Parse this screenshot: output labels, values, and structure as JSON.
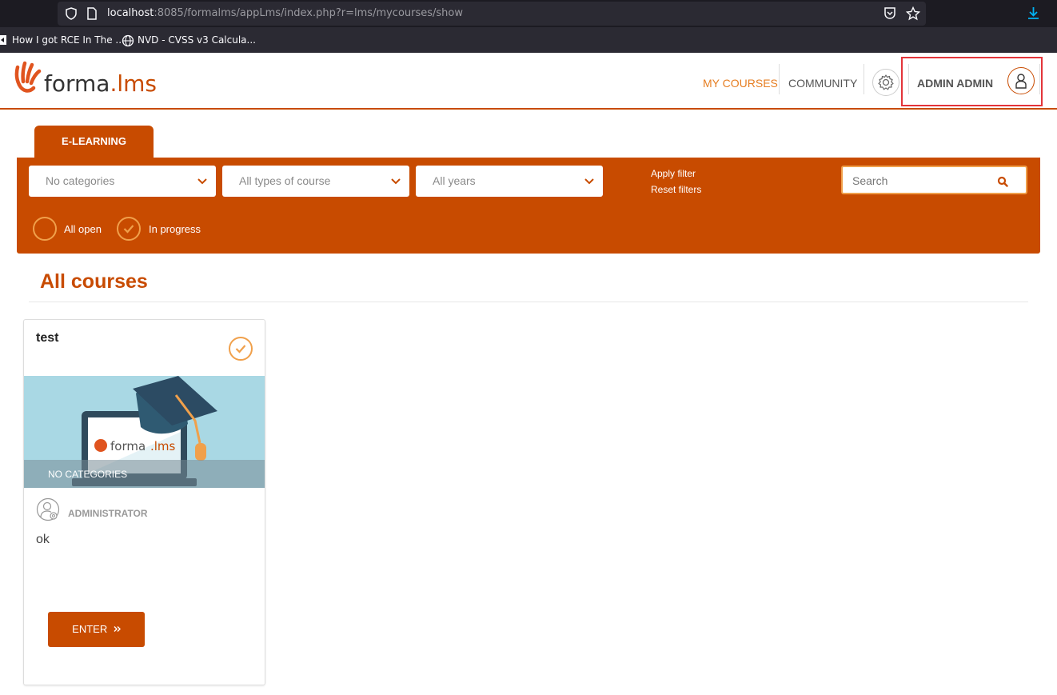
{
  "browser": {
    "url_host": "localhost",
    "url_rest": ":8085/formalms/appLms/index.php?r=lms/mycourses/show",
    "bookmarks": [
      "How I got RCE In The ...",
      "NVD - CVSS v3 Calcula..."
    ]
  },
  "header": {
    "logo_main": "forma",
    "logo_dot": ".",
    "logo_sub": "lms",
    "nav": {
      "my_courses": "MY COURSES",
      "community": "COMMUNITY"
    },
    "user_name": "ADMIN ADMIN"
  },
  "tabs": {
    "elearning": "E-LEARNING"
  },
  "filters": {
    "categories": "No categories",
    "course_types": "All types of course",
    "years": "All years",
    "apply": "Apply filter",
    "reset": "Reset filters",
    "search_placeholder": "Search",
    "status_options": [
      {
        "label": "All open",
        "checked": false
      },
      {
        "label": "In progress",
        "checked": true
      }
    ]
  },
  "section": {
    "title": "All courses"
  },
  "courses": [
    {
      "title": "test",
      "category": "NO CATEGORIES",
      "role": "ADMINISTRATOR",
      "description": "ok",
      "enter_label": "ENTER",
      "in_progress": true
    }
  ],
  "colors": {
    "accent": "#c84b00",
    "highlight": "#f0a04b",
    "annotation": "#e3343a"
  }
}
